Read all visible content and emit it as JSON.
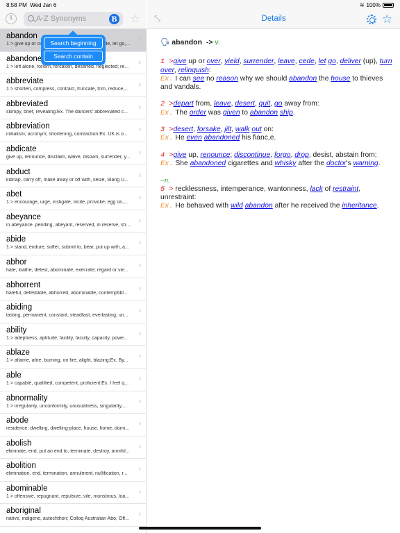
{
  "status": {
    "time": "8:58 PM",
    "date": "Wed Jan 6",
    "battery": "100%",
    "battery_level": 1.0
  },
  "search": {
    "placeholder": "A-Z Synonyms",
    "mode_badge": "B"
  },
  "popover": {
    "options": [
      "Search beginning",
      "Search contain"
    ]
  },
  "detail_title": "Details",
  "colors": {
    "accent": "#1a7ae8",
    "sense_number": "#e02020",
    "example": "#f09030",
    "link": "#1010e0",
    "pos": "#2ca02c",
    "selected_row": "#d1d1d6"
  },
  "list": [
    {
      "word": "abandon",
      "summary": "1 > give up or over, yield, surrender, leave, cede, let go,...",
      "selected": true
    },
    {
      "word": "abandoned",
      "summary": "1 > left alone, forlorn, forsaken, deserted, neglected; re..."
    },
    {
      "word": "abbreviate",
      "summary": "1 > shorten, compress, contract, truncate, trim, reduce,..."
    },
    {
      "word": "abbreviated",
      "summary": "skimpy, brief, revealing:Ex. The dancers' abbreviated c..."
    },
    {
      "word": "abbreviation",
      "summary": "initialism; acronym; shortening, contraction:Ex. UK is o..."
    },
    {
      "word": "abdicate",
      "summary": "give up, renounce, disclaim, waive, disown, surrender, y..."
    },
    {
      "word": "abduct",
      "summary": "kidnap, carry off, make away or off with, seize, Slang U..."
    },
    {
      "word": "abet",
      "summary": "1 > encourage, urge, instigate, incite, provoke, egg on,..."
    },
    {
      "word": "abeyance",
      "summary": "in abeyance. pending, abeyant, reserved, in reserve, sh..."
    },
    {
      "word": "abide",
      "summary": "1 > stand, endure, suffer, submit to, bear, put up with, a..."
    },
    {
      "word": "abhor",
      "summary": "hate, loathe, detest, abominate, execrate; regard or vie..."
    },
    {
      "word": "abhorrent",
      "summary": "hateful, detestable, abhorred, abominable, contemptibl..."
    },
    {
      "word": "abiding",
      "summary": "lasting, permanent, constant, steadfast, everlasting, un..."
    },
    {
      "word": "ability",
      "summary": "1 > adeptness, aptitude, facility, faculty, capacity, powe..."
    },
    {
      "word": "ablaze",
      "summary": "1 > aflame, afire, burning, on fire, alight, blazing:Ex. By..."
    },
    {
      "word": "able",
      "summary": "1 > capable, qualified, competent, proficient:Ex. I feel q..."
    },
    {
      "word": "abnormality",
      "summary": "1 > irregularity, unconformity, unusualness, singularity,..."
    },
    {
      "word": "abode",
      "summary": "residence, dwelling, dwelling-place, house, home, domi..."
    },
    {
      "word": "abolish",
      "summary": "eliminate, end, put an end to, terminate, destroy, annihil..."
    },
    {
      "word": "abolition",
      "summary": "elimination, end, termination, annulment, nullification, r..."
    },
    {
      "word": "abominable",
      "summary": "1 > offensive, repugnant, repulsive, vile, monstrous, loa..."
    },
    {
      "word": "aboriginal",
      "summary": "native, indigene, autochthon; Colloq Australian Abo, Off..."
    }
  ],
  "entry": {
    "headword": "abandon",
    "arrow": "->",
    "pos": "v.",
    "senses": [
      {
        "num": "1 >",
        "def": [
          [
            "l",
            "give"
          ],
          [
            "t",
            " up or "
          ],
          [
            "l",
            "over"
          ],
          [
            "t",
            ", "
          ],
          [
            "l",
            "yield"
          ],
          [
            "t",
            ", "
          ],
          [
            "l",
            "surrender"
          ],
          [
            "t",
            ", "
          ],
          [
            "l",
            "leave"
          ],
          [
            "t",
            ", "
          ],
          [
            "l",
            "cede"
          ],
          [
            "t",
            ", "
          ],
          [
            "l",
            "let"
          ],
          [
            "t",
            " "
          ],
          [
            "l",
            "go"
          ],
          [
            "t",
            ", "
          ],
          [
            "l",
            "deliver"
          ],
          [
            "t",
            " (up), "
          ],
          [
            "l",
            "turn"
          ],
          [
            "t",
            " "
          ],
          [
            "l",
            "over"
          ],
          [
            "t",
            ", "
          ],
          [
            "l",
            "relinquish"
          ],
          [
            "t",
            ":"
          ]
        ],
        "ex": [
          [
            "t",
            "I can "
          ],
          [
            "l",
            "see"
          ],
          [
            "t",
            " no "
          ],
          [
            "l",
            "reason"
          ],
          [
            "t",
            " why we should "
          ],
          [
            "l",
            "abandon"
          ],
          [
            "t",
            " the "
          ],
          [
            "l",
            "house"
          ],
          [
            "t",
            " to thieves and vandals."
          ]
        ]
      },
      {
        "num": "2 >",
        "def": [
          [
            "l",
            "depart"
          ],
          [
            "t",
            " from, "
          ],
          [
            "l",
            "leave"
          ],
          [
            "t",
            ", "
          ],
          [
            "l",
            "desert"
          ],
          [
            "t",
            ", "
          ],
          [
            "l",
            "quit"
          ],
          [
            "t",
            ", "
          ],
          [
            "l",
            "go"
          ],
          [
            "t",
            " away from:"
          ]
        ],
        "ex": [
          [
            "t",
            "The "
          ],
          [
            "l",
            "order"
          ],
          [
            "t",
            " was "
          ],
          [
            "l",
            "given"
          ],
          [
            "t",
            " to "
          ],
          [
            "l",
            "abandon"
          ],
          [
            "t",
            " "
          ],
          [
            "l",
            "ship"
          ],
          [
            "t",
            "."
          ]
        ]
      },
      {
        "num": "3 >",
        "def": [
          [
            "l",
            "desert"
          ],
          [
            "t",
            ", "
          ],
          [
            "l",
            "forsake"
          ],
          [
            "t",
            ", "
          ],
          [
            "l",
            "jilt"
          ],
          [
            "t",
            ", "
          ],
          [
            "l",
            "walk"
          ],
          [
            "t",
            " "
          ],
          [
            "l",
            "out"
          ],
          [
            "t",
            " on:"
          ]
        ],
        "ex": [
          [
            "t",
            "He "
          ],
          [
            "l",
            "even"
          ],
          [
            "t",
            " "
          ],
          [
            "l",
            "abandoned"
          ],
          [
            "t",
            " his fianc,e."
          ]
        ]
      },
      {
        "num": "4 >",
        "def": [
          [
            "l",
            "give"
          ],
          [
            "t",
            " up, "
          ],
          [
            "l",
            "renounce"
          ],
          [
            "t",
            "; "
          ],
          [
            "l",
            "discontinue"
          ],
          [
            "t",
            ", "
          ],
          [
            "l",
            "forgo"
          ],
          [
            "t",
            ", "
          ],
          [
            "l",
            "drop"
          ],
          [
            "t",
            ", desist, abstain from:"
          ]
        ],
        "ex": [
          [
            "t",
            "She "
          ],
          [
            "l",
            "abandoned"
          ],
          [
            "t",
            " cigarettes and "
          ],
          [
            "l",
            "whisky"
          ],
          [
            "t",
            " after the "
          ],
          [
            "l",
            "doctor"
          ],
          [
            "t",
            "'s "
          ],
          [
            "l",
            "warning"
          ],
          [
            "t",
            "."
          ]
        ]
      },
      {
        "pos_tag": "--n.",
        "num": "5 >",
        "def": [
          [
            "t",
            " recklessness, intemperance, wantonness, "
          ],
          [
            "l",
            "lack"
          ],
          [
            "t",
            " of "
          ],
          [
            "l",
            "restraint"
          ],
          [
            "t",
            ", unrestraint:"
          ]
        ],
        "ex": [
          [
            "t",
            "He behaved with "
          ],
          [
            "l",
            "wild"
          ],
          [
            "t",
            " "
          ],
          [
            "l",
            "abandon"
          ],
          [
            "t",
            " after he received the "
          ],
          [
            "l",
            "inheritance"
          ],
          [
            "t",
            "."
          ]
        ]
      }
    ],
    "example_label": "Ex."
  }
}
